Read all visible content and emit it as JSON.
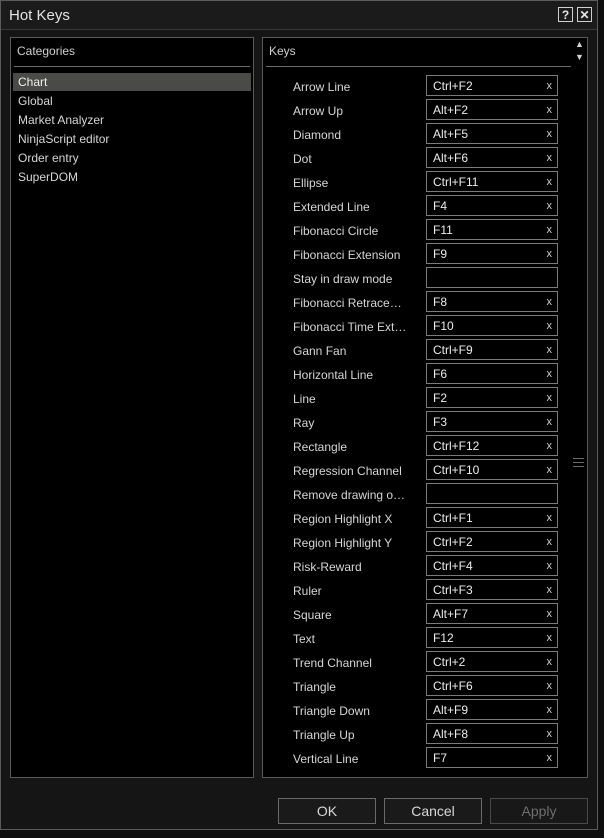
{
  "window": {
    "title": "Hot Keys",
    "help_glyph": "?",
    "close_glyph": "✕"
  },
  "categories_panel": {
    "header": "Categories",
    "items": [
      "Chart",
      "Global",
      "Market Analyzer",
      "NinjaScript editor",
      "Order entry",
      "SuperDOM"
    ],
    "selected": "Chart"
  },
  "keys_panel": {
    "header": "Keys",
    "clear_glyph": "x",
    "rows": [
      {
        "label": "Arrow Line",
        "value": "Ctrl+F2"
      },
      {
        "label": "Arrow Up",
        "value": "Alt+F2"
      },
      {
        "label": "Diamond",
        "value": "Alt+F5"
      },
      {
        "label": "Dot",
        "value": "Alt+F6"
      },
      {
        "label": "Ellipse",
        "value": "Ctrl+F11"
      },
      {
        "label": "Extended Line",
        "value": "F4"
      },
      {
        "label": "Fibonacci Circle",
        "value": "F11"
      },
      {
        "label": "Fibonacci Extension",
        "value": "F9"
      },
      {
        "label": "Stay in draw mode",
        "value": ""
      },
      {
        "label": "Fibonacci Retrace…",
        "value": "F8"
      },
      {
        "label": "Fibonacci Time Ext…",
        "value": "F10"
      },
      {
        "label": "Gann Fan",
        "value": "Ctrl+F9"
      },
      {
        "label": "Horizontal Line",
        "value": "F6"
      },
      {
        "label": "Line",
        "value": "F2"
      },
      {
        "label": "Ray",
        "value": "F3"
      },
      {
        "label": "Rectangle",
        "value": "Ctrl+F12"
      },
      {
        "label": "Regression Channel",
        "value": "Ctrl+F10"
      },
      {
        "label": "Remove drawing o…",
        "value": ""
      },
      {
        "label": "Region Highlight X",
        "value": "Ctrl+F1"
      },
      {
        "label": "Region Highlight Y",
        "value": "Ctrl+F2"
      },
      {
        "label": "Risk-Reward",
        "value": "Ctrl+F4"
      },
      {
        "label": "Ruler",
        "value": "Ctrl+F3"
      },
      {
        "label": "Square",
        "value": "Alt+F7"
      },
      {
        "label": "Text",
        "value": "F12"
      },
      {
        "label": "Trend Channel",
        "value": "Ctrl+2"
      },
      {
        "label": "Triangle",
        "value": "Ctrl+F6"
      },
      {
        "label": "Triangle Down",
        "value": "Alt+F9"
      },
      {
        "label": "Triangle Up",
        "value": "Alt+F8"
      },
      {
        "label": "Vertical Line",
        "value": "F7"
      }
    ]
  },
  "scrollbar": {
    "up_glyph": "▲",
    "down_glyph": "▼"
  },
  "footer": {
    "ok_label": "OK",
    "cancel_label": "Cancel",
    "apply_label": "Apply"
  }
}
